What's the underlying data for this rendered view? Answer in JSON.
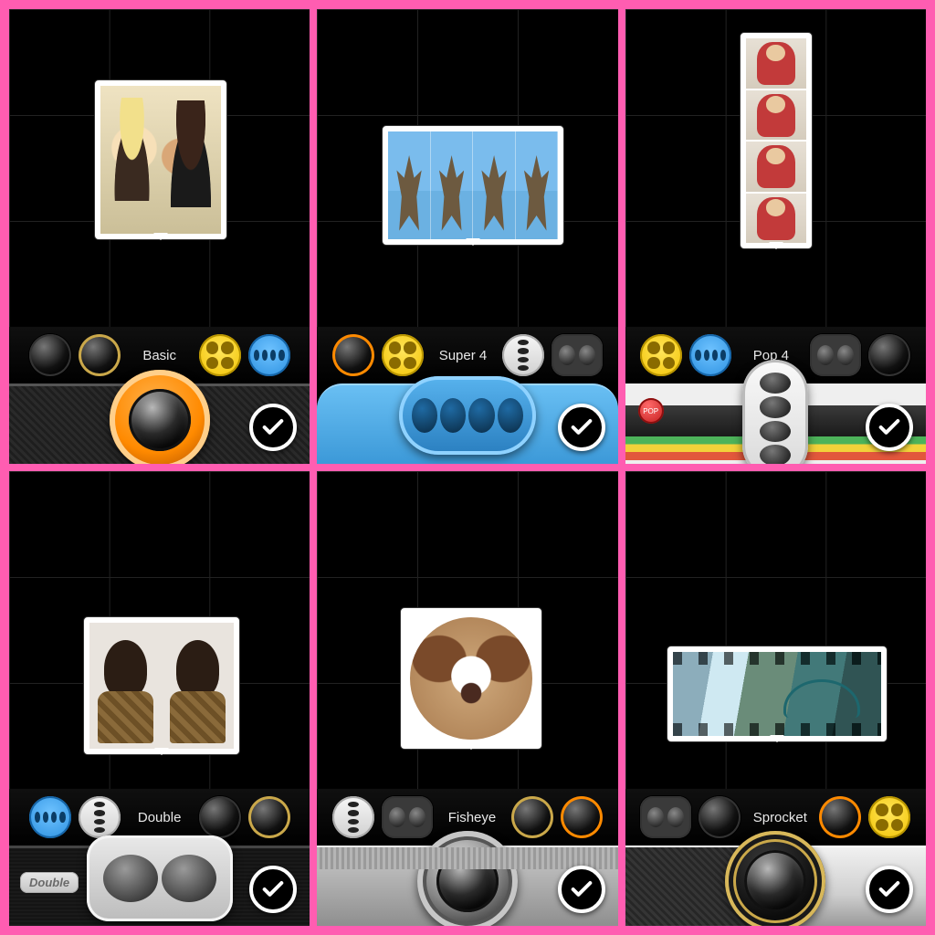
{
  "panels": [
    {
      "mode_label": "Basic",
      "confirm_icon": "check-icon",
      "badge": null
    },
    {
      "mode_label": "Super 4",
      "confirm_icon": "check-icon",
      "badge": null
    },
    {
      "mode_label": "Pop 4",
      "confirm_icon": "check-icon",
      "badge": "POP"
    },
    {
      "mode_label": "Double",
      "confirm_icon": "check-icon",
      "badge": "Double"
    },
    {
      "mode_label": "Fisheye",
      "confirm_icon": "check-icon",
      "badge": null
    },
    {
      "mode_label": "Sprocket",
      "confirm_icon": "check-icon",
      "badge": null
    }
  ]
}
